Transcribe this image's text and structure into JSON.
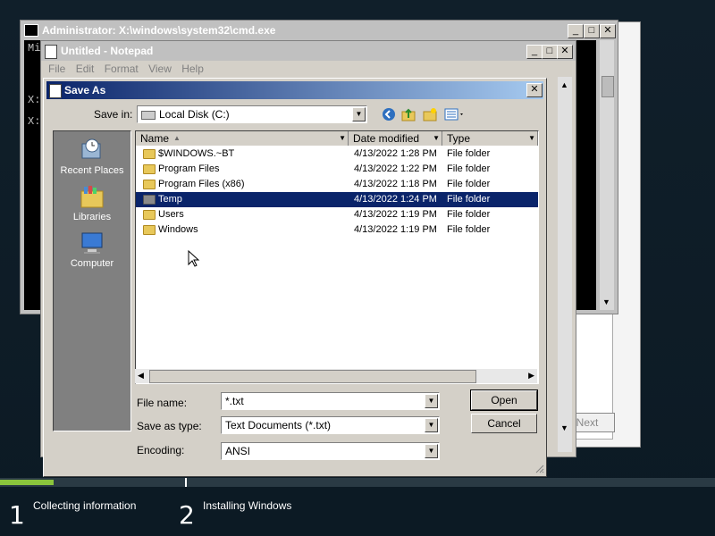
{
  "cmd": {
    "title": "Administrator: X:\\windows\\system32\\cmd.exe",
    "lines": [
      "Mi",
      "X:",
      "X:"
    ]
  },
  "notepad": {
    "title": "Untitled - Notepad",
    "menu": [
      "File",
      "Edit",
      "Format",
      "View",
      "Help"
    ]
  },
  "saveas": {
    "title": "Save As",
    "save_in_label": "Save in:",
    "save_in_value": "Local Disk (C:)",
    "places": [
      {
        "label": "Recent Places",
        "icon": "recent-places-icon"
      },
      {
        "label": "Libraries",
        "icon": "libraries-icon"
      },
      {
        "label": "Computer",
        "icon": "computer-icon"
      }
    ],
    "columns": [
      "Name",
      "Date modified",
      "Type"
    ],
    "rows": [
      {
        "name": "$WINDOWS.~BT",
        "date": "4/13/2022 1:28 PM",
        "type": "File folder",
        "selected": false
      },
      {
        "name": "Program Files",
        "date": "4/13/2022 1:22 PM",
        "type": "File folder",
        "selected": false
      },
      {
        "name": "Program Files (x86)",
        "date": "4/13/2022 1:18 PM",
        "type": "File folder",
        "selected": false
      },
      {
        "name": "Temp",
        "date": "4/13/2022 1:24 PM",
        "type": "File folder",
        "selected": true
      },
      {
        "name": "Users",
        "date": "4/13/2022 1:19 PM",
        "type": "File folder",
        "selected": false
      },
      {
        "name": "Windows",
        "date": "4/13/2022 1:19 PM",
        "type": "File folder",
        "selected": false
      }
    ],
    "file_name_label": "File name:",
    "file_name_value": "*.txt",
    "save_type_label": "Save as type:",
    "save_type_value": "Text Documents (*.txt)",
    "encoding_label": "Encoding:",
    "encoding_value": "ANSI",
    "open_button": "Open",
    "cancel_button": "Cancel"
  },
  "setup": {
    "next_button": "Next",
    "progress": 0.075,
    "steps": [
      {
        "num": "1",
        "label": "Collecting information"
      },
      {
        "num": "2",
        "label": "Installing Windows"
      }
    ]
  },
  "colors": {
    "selection": "#0a246a",
    "progress": "#8ac43c",
    "titlebar": "#0a246a"
  }
}
